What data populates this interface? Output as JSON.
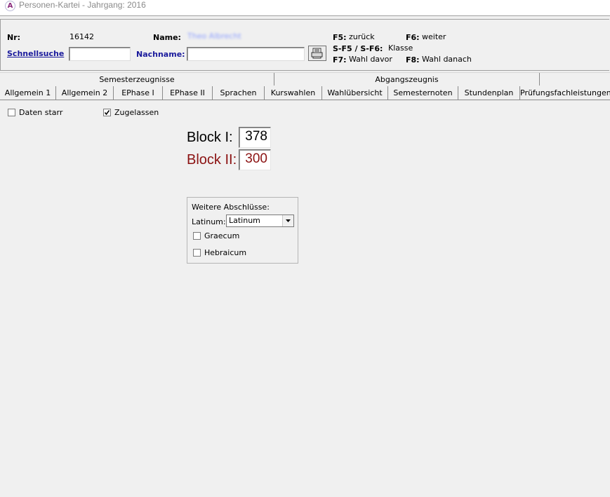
{
  "window": {
    "title": "Personen-Kartei - Jahrgang: 2016",
    "icon": "app-logo-icon",
    "icon_glyph": "A"
  },
  "header": {
    "nr_label": "Nr:",
    "nr_value": "16142",
    "name_label": "Name:",
    "name_value": "Theo Albrecht",
    "quicksearch_label": "Schnellsuche",
    "quicksearch_value": "",
    "lastname_label": "Nachname:",
    "lastname_value": "",
    "print_icon": "printer-icon",
    "shortcuts": [
      {
        "key": "F5:",
        "text": "zurück"
      },
      {
        "key": "F6:",
        "text": "weiter"
      },
      {
        "key": "S-F5 / S-F6:",
        "text": "Klasse"
      },
      {
        "key": "F7:",
        "text": "Wahl davor"
      },
      {
        "key": "F8:",
        "text": "Wahl danach"
      }
    ]
  },
  "tabs": {
    "top_row": [
      "Semesterzeugnisse",
      "Abgangszeugnis"
    ],
    "bottom_row": [
      "Allgemein 1",
      "Allgemein 2",
      "EPhase I",
      "EPhase II",
      "Sprachen",
      "Kurswahlen",
      "Wahlübersicht",
      "Semesternoten",
      "Stundenplan",
      "Prüfungsfachleistungen"
    ]
  },
  "options": {
    "daten_starr": {
      "label": "Daten starr",
      "checked": false
    },
    "zugelassen": {
      "label": "Zugelassen",
      "checked": true
    }
  },
  "blocks": {
    "block1_label": "Block I:",
    "block1_value": "378",
    "block2_label": "Block II:",
    "block2_value": "300",
    "block2_color": "#8b1212"
  },
  "abschluesse": {
    "title": "Weitere Abschlüsse:",
    "latinum_label": "Latinum:",
    "latinum_value": "Latinum",
    "graecum": {
      "label": "Graecum",
      "checked": false
    },
    "hebraicum": {
      "label": "Hebraicum",
      "checked": false
    }
  }
}
